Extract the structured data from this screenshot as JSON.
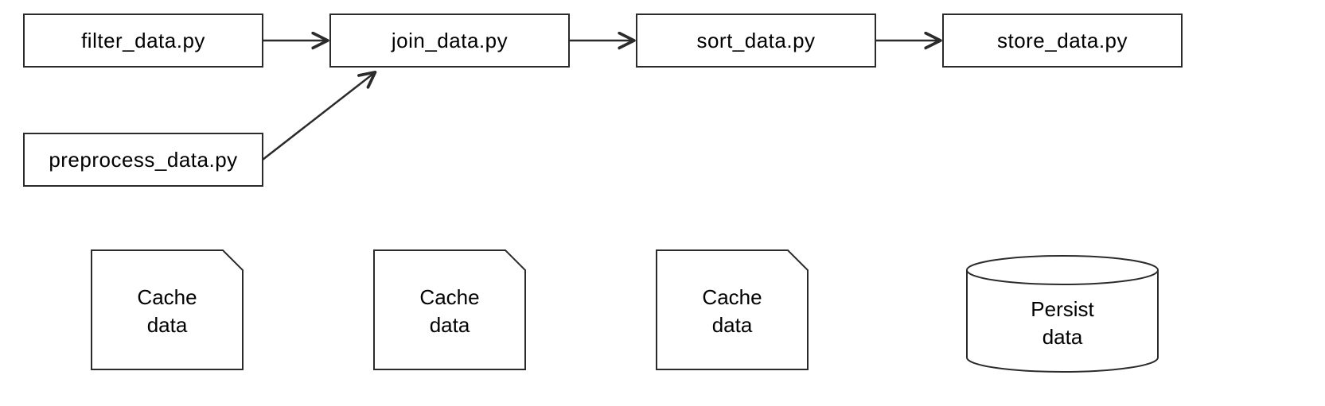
{
  "nodes": {
    "filter": {
      "label": "filter_data.py"
    },
    "join": {
      "label": "join_data.py"
    },
    "sort": {
      "label": "sort_data.py"
    },
    "store": {
      "label": "store_data.py"
    },
    "preprocess": {
      "label": "preprocess_data.py"
    }
  },
  "storage": {
    "cache1": {
      "line1": "Cache",
      "line2": "data"
    },
    "cache2": {
      "line1": "Cache",
      "line2": "data"
    },
    "cache3": {
      "line1": "Cache",
      "line2": "data"
    },
    "db": {
      "line1": "Persist",
      "line2": "data"
    }
  },
  "colors": {
    "stroke": "#2b2b2b",
    "bg": "#ffffff"
  }
}
